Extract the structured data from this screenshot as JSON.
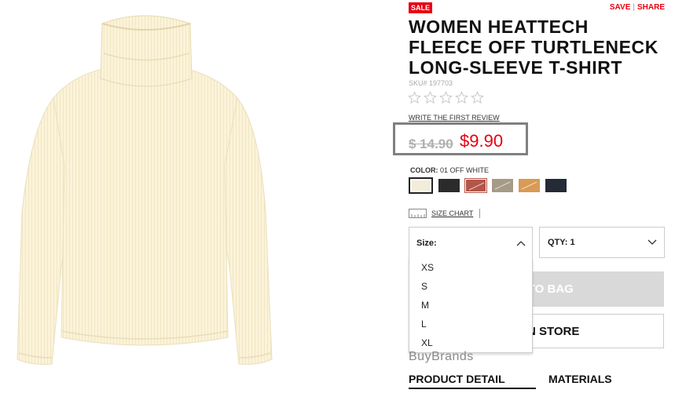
{
  "product": {
    "badge": "SALE",
    "title": "WOMEN HEATTECH FLEECE OFF TURTLENECK LONG-SLEEVE T-SHIRT",
    "sku": "SKU# 197703",
    "rating_stars": 0,
    "review_link": "WRITE THE FIRST REVIEW",
    "old_price": "$ 14.90",
    "new_price": "$9.90"
  },
  "top_links": {
    "save": "SAVE",
    "separator": "|",
    "share": "SHARE"
  },
  "color": {
    "label_prefix": "COLOR:",
    "selected_name": "01 OFF WHITE",
    "swatches": [
      "#f3ecd8",
      "#2b2b2b",
      "#b3564a",
      "#a59b87",
      "#d99a55",
      "#242a36"
    ]
  },
  "size_chart": {
    "label": "SIZE CHART"
  },
  "size_select": {
    "label": "Size:",
    "options": [
      "XS",
      "S",
      "M",
      "L",
      "XL"
    ]
  },
  "qty_select": {
    "label": "QTY: 1"
  },
  "buttons": {
    "add_to_bag": "ADD TO BAG",
    "find_in_store": "FIND IN STORE"
  },
  "watermark": "BuyBrands",
  "tabs": [
    "PRODUCT DETAIL",
    "MATERIALS"
  ],
  "colors": {
    "sale_red": "#e60012",
    "price_frame": "#808080"
  }
}
